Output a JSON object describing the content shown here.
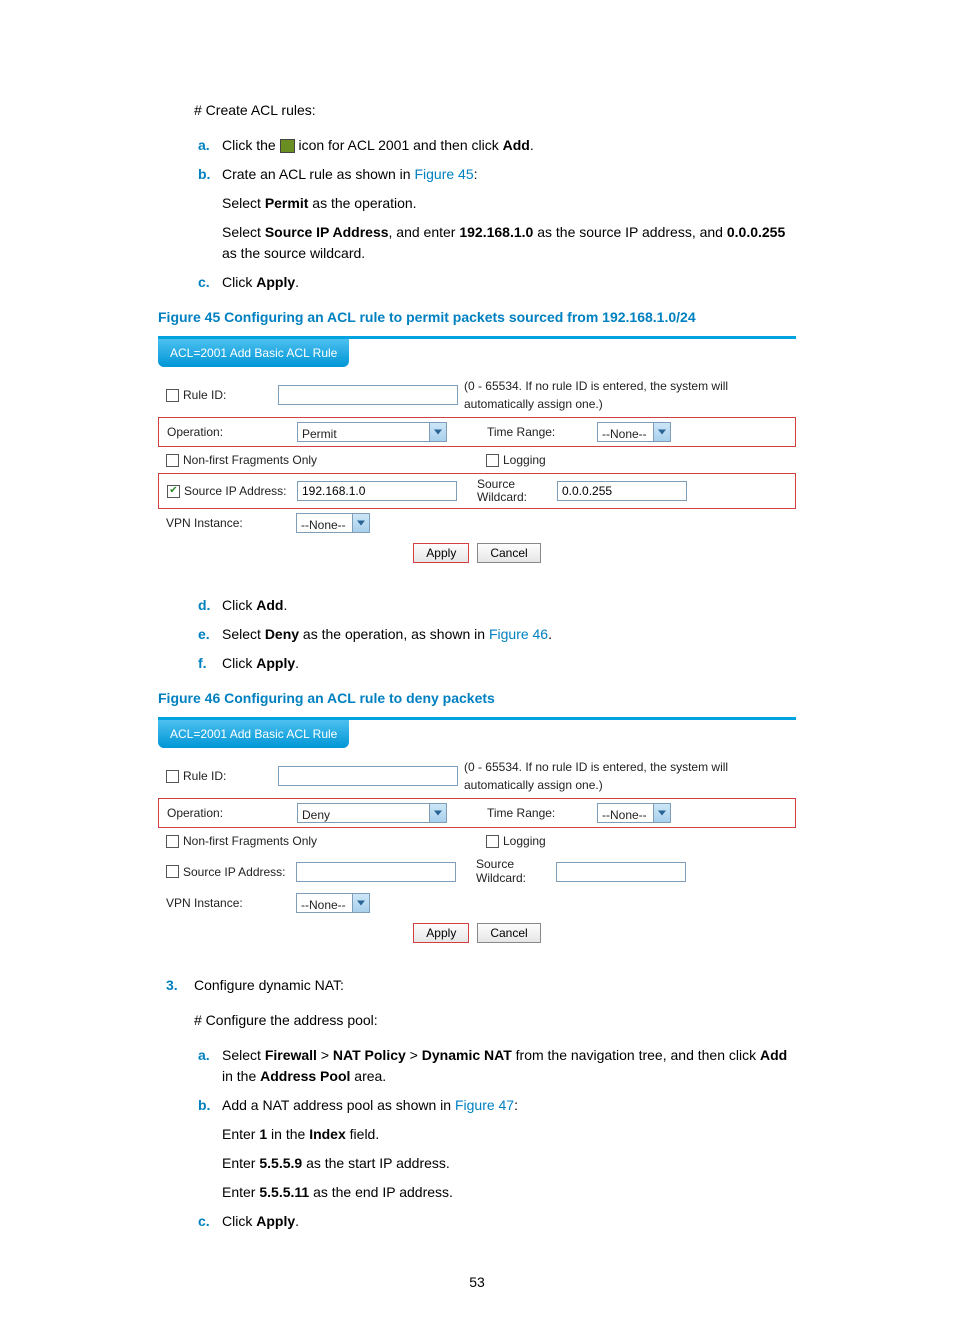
{
  "intro": "# Create ACL rules:",
  "steps1": {
    "a": {
      "pre": "Click the ",
      "post": " icon for ACL 2001 and then click ",
      "bold": "Add",
      "end": "."
    },
    "b": {
      "text": "Crate an ACL rule as shown in ",
      "link": "Figure 45",
      "end": ":"
    },
    "b_cont1": {
      "pre": "Select ",
      "bold": "Permit",
      "post": " as the operation."
    },
    "b_cont2": {
      "pre": "Select ",
      "b1": "Source IP Address",
      "mid1": ", and enter ",
      "b2": "192.168.1.0",
      "mid2": " as the source IP address, and ",
      "b3": "0.0.0.255",
      "post": " as the source wildcard."
    },
    "c": {
      "pre": "Click ",
      "bold": "Apply",
      "end": "."
    },
    "d": {
      "pre": "Click ",
      "bold": "Add",
      "end": "."
    },
    "e": {
      "pre": "Select ",
      "bold": "Deny",
      "mid": " as the operation, as shown in ",
      "link": "Figure 46",
      "end": "."
    },
    "f": {
      "pre": "Click ",
      "bold": "Apply",
      "end": "."
    }
  },
  "fig45": {
    "heading": "Figure 45 Configuring an ACL rule to permit packets sourced from 192.168.1.0/24",
    "tab": "ACL=2001 Add Basic ACL Rule",
    "ruleid_label": "Rule ID:",
    "ruleid_note": "(0 - 65534. If no rule ID is entered, the system will automatically assign one.)",
    "operation_label": "Operation:",
    "operation_value": "Permit",
    "timerange_label": "Time Range:",
    "timerange_value": "--None--",
    "nonfirst_label": "Non-first Fragments Only",
    "logging_label": "Logging",
    "srcip_label": "Source IP Address:",
    "srcip_value": "192.168.1.0",
    "srcwild_label": "Source Wildcard:",
    "srcwild_value": "0.0.0.255",
    "vpn_label": "VPN Instance:",
    "vpn_value": "--None--",
    "apply": "Apply",
    "cancel": "Cancel"
  },
  "fig46": {
    "heading": "Figure 46 Configuring an ACL rule to deny packets",
    "tab": "ACL=2001 Add Basic ACL Rule",
    "ruleid_label": "Rule ID:",
    "ruleid_note": "(0 - 65534. If no rule ID is entered, the system will automatically assign one.)",
    "operation_label": "Operation:",
    "operation_value": "Deny",
    "timerange_label": "Time Range:",
    "timerange_value": "--None--",
    "nonfirst_label": "Non-first Fragments Only",
    "logging_label": "Logging",
    "srcip_label": "Source IP Address:",
    "srcip_value": "",
    "srcwild_label": "Source Wildcard:",
    "srcwild_value": "",
    "vpn_label": "VPN Instance:",
    "vpn_value": "--None--",
    "apply": "Apply",
    "cancel": "Cancel"
  },
  "step3": {
    "num": "3.",
    "text": "Configure dynamic NAT:",
    "sub_intro": "# Configure the address pool:",
    "a": {
      "pre": "Select ",
      "b1": "Firewall",
      "gt1": " > ",
      "b2": "NAT Policy",
      "gt2": " > ",
      "b3": "Dynamic NAT",
      "mid": " from the navigation tree, and then click ",
      "b4": "Add",
      "mid2": " in the ",
      "b5": "Address Pool",
      "post": " area."
    },
    "b": {
      "text": "Add a NAT address pool as shown in ",
      "link": "Figure 47",
      "end": ":"
    },
    "b_c1": {
      "pre": "Enter ",
      "b1": "1",
      "mid": " in the ",
      "b2": "Index",
      "post": " field."
    },
    "b_c2": {
      "pre": "Enter ",
      "b1": "5.5.5.9",
      "post": " as the start IP address."
    },
    "b_c3": {
      "pre": "Enter ",
      "b1": "5.5.5.11",
      "post": " as the end IP address."
    },
    "c": {
      "pre": "Click ",
      "bold": "Apply",
      "end": "."
    }
  },
  "page_num": "53"
}
